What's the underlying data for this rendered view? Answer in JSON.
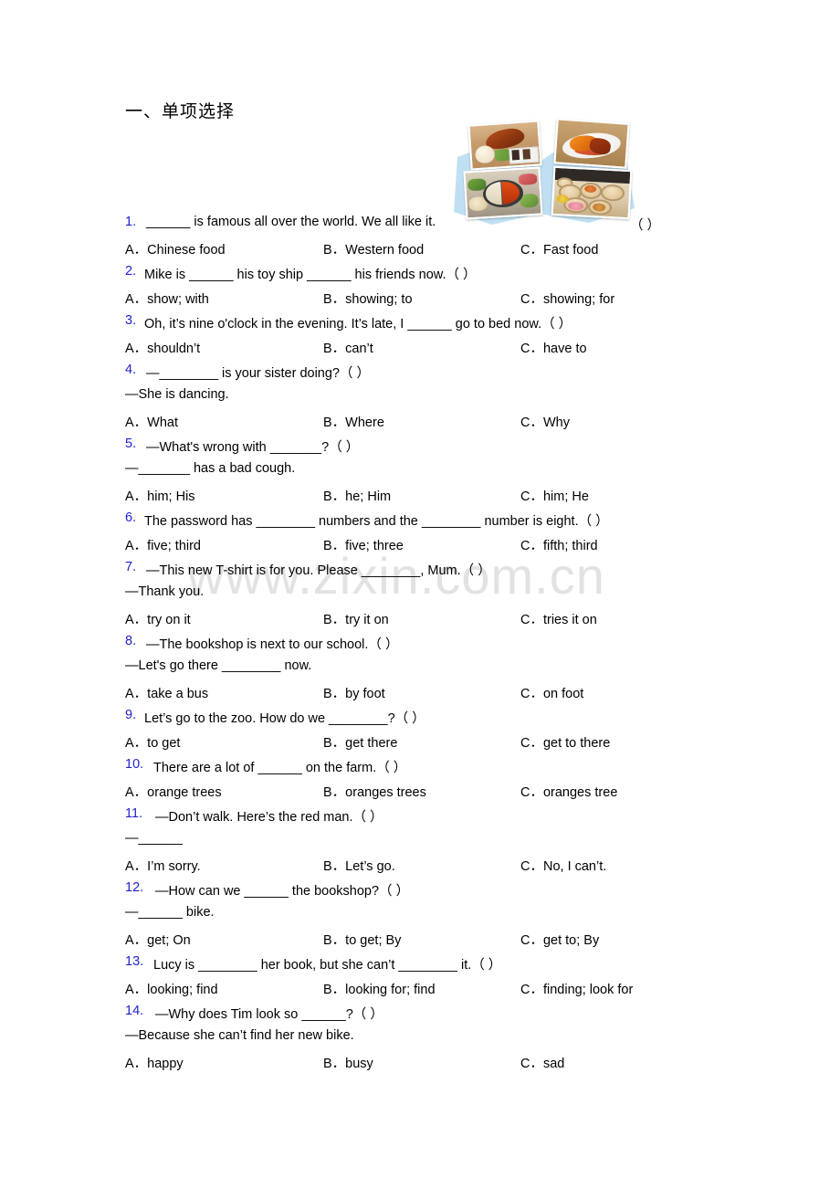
{
  "document": {
    "section_title": "一、单项选择",
    "watermark": "www.zixin.com.cn",
    "trailing_marker": "（ ）"
  },
  "collage": {
    "name": "chinese-food-photo-collage",
    "background_color": "#bfe0f2",
    "photos": [
      {
        "alt": "roast duck on wooden board"
      },
      {
        "alt": "braised pork dish on white plate"
      },
      {
        "alt": "hotpot with vegetables"
      },
      {
        "alt": "dim sum in bamboo steamers"
      }
    ]
  },
  "questions": [
    {
      "number": "1.",
      "stem": "______ is famous all over the world. We all like it.",
      "stem_lines": [],
      "options": [
        "A．Chinese food",
        "B．Western food",
        "C．Fast food"
      ],
      "right_marker": "（ ）"
    },
    {
      "number": "2.",
      "stem": "Mike is ______ his toy ship ______ his friends now.（ ）",
      "stem_lines": [],
      "options": [
        "A．show; with",
        "B．showing; to",
        "C．showing; for"
      ]
    },
    {
      "number": "3.",
      "stem": "Oh, it’s nine o'clock in the evening. It’s late, I ______ go to bed now.（ ）",
      "stem_lines": [],
      "options": [
        "A．shouldn’t",
        "B．can’t",
        "C．have to"
      ]
    },
    {
      "number": "4.",
      "stem": "—________ is your sister doing?（  ）",
      "stem_lines": [
        "—She is dancing."
      ],
      "options": [
        "A．What",
        "B．Where",
        "C．Why"
      ]
    },
    {
      "number": "5.",
      "stem": "—What's wrong with _______?（  ）",
      "stem_lines": [
        "—_______ has a bad cough."
      ],
      "options": [
        "A．him; His",
        "B．he; Him",
        "C．him; He"
      ]
    },
    {
      "number": "6.",
      "stem": "The password has ________ numbers and the ________ number is eight.（  ）",
      "stem_lines": [],
      "options": [
        "A．five; third",
        "B．five; three",
        "C．fifth; third"
      ]
    },
    {
      "number": "7.",
      "stem": "—This new T-shirt is for you. Please ________, Mum.（  ）",
      "stem_lines": [
        "—Thank you."
      ],
      "options": [
        "A．try on it",
        "B．try it on",
        "C．tries it on"
      ]
    },
    {
      "number": "8.",
      "stem": "—The bookshop is next to our school.（  ）",
      "stem_lines": [
        "—Let's go there ________ now."
      ],
      "options": [
        "A．take a bus",
        "B．by foot",
        "C．on foot"
      ]
    },
    {
      "number": "9.",
      "stem": "Let’s go to the zoo. How do we ________?（  ）",
      "stem_lines": [],
      "options": [
        "A．to get",
        "B．get there",
        "C．get to there"
      ]
    },
    {
      "number": "10.",
      "stem": "There are a lot of ______ on the farm.（ ）",
      "stem_lines": [],
      "options": [
        "A．orange trees",
        "B．oranges trees",
        "C．oranges tree"
      ]
    },
    {
      "number": "11.",
      "stem": "—Don’t walk. Here’s the red man.（ ）",
      "stem_lines": [
        "—______"
      ],
      "options": [
        "A．I’m sorry.",
        "B．Let’s go.",
        "C．No, I can’t."
      ]
    },
    {
      "number": "12.",
      "stem": "—How can we ______ the bookshop?（ ）",
      "stem_lines": [
        "—______ bike."
      ],
      "options": [
        "A．get; On",
        "B．to get; By",
        "C．get to; By"
      ]
    },
    {
      "number": "13.",
      "stem": "Lucy is ________ her book, but she can’t ________ it.（ ）",
      "stem_lines": [],
      "options": [
        "A．looking; find",
        "B．looking for; find",
        "C．finding; look for"
      ]
    },
    {
      "number": "14.",
      "stem": "—Why does Tim look so ______?（  ）",
      "stem_lines": [
        "—Because she can’t find her new bike."
      ],
      "options": [
        "A．happy",
        "B．busy",
        "C．sad"
      ]
    }
  ]
}
